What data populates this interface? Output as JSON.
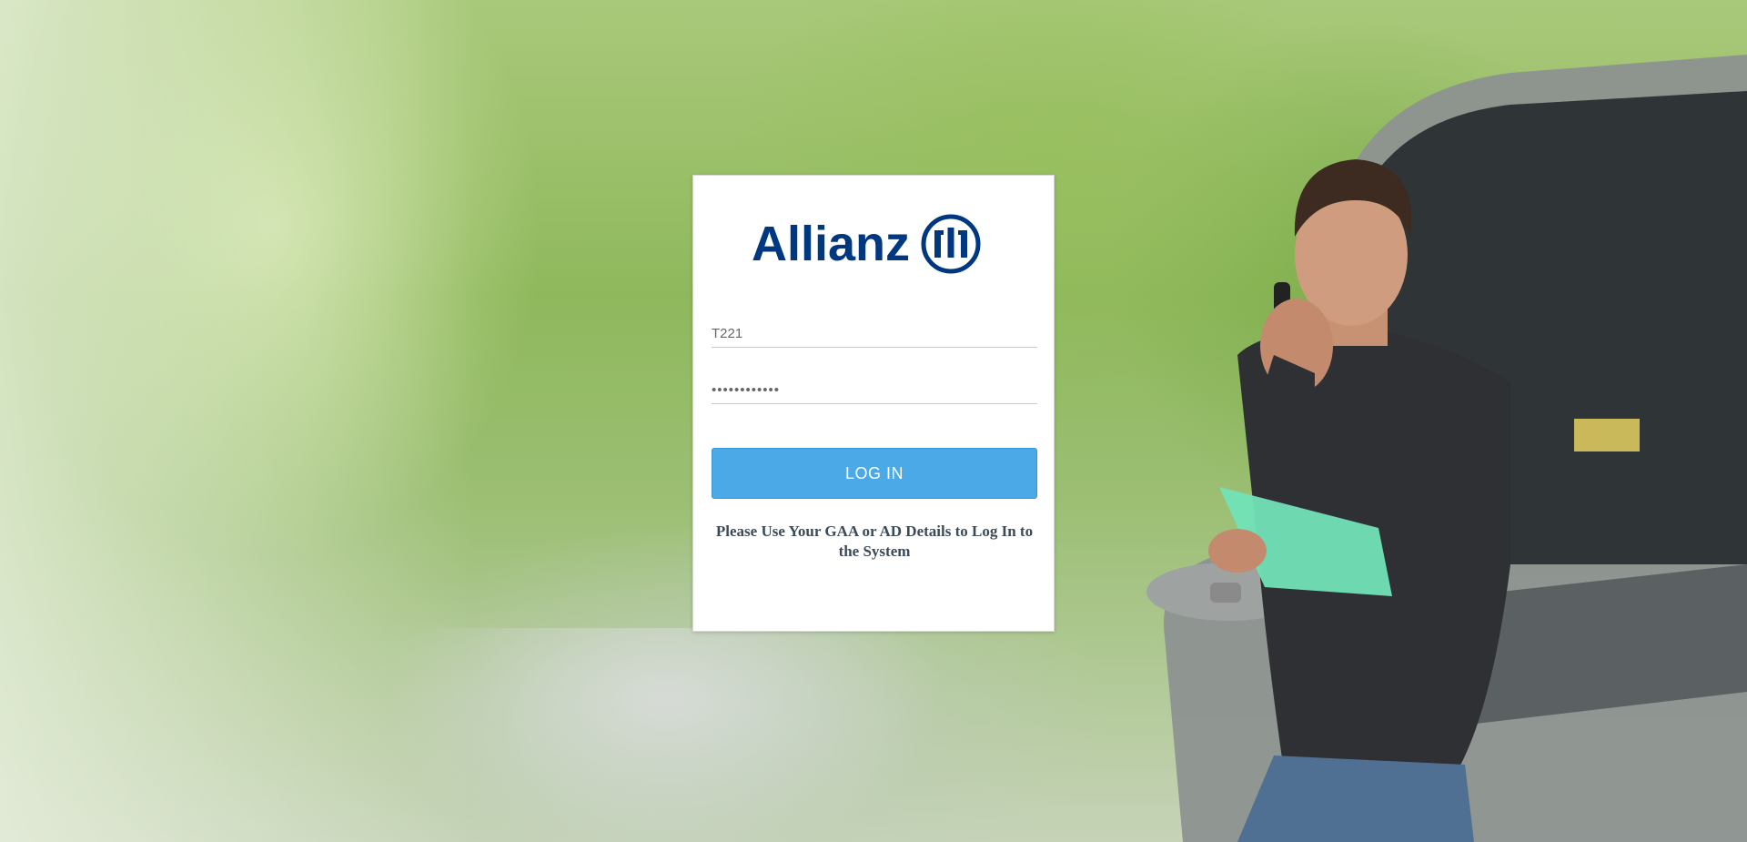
{
  "brand": {
    "name": "Allianz",
    "primary_color": "#003781"
  },
  "login": {
    "username_value": "T221",
    "password_value": "••••••••••••",
    "login_button_label": "LOG IN",
    "button_color": "#4aa9e6",
    "help_text": "Please Use Your GAA or AD Details to Log In to the System"
  },
  "background": {
    "icon": "man-on-phone-with-broken-car-photo"
  }
}
